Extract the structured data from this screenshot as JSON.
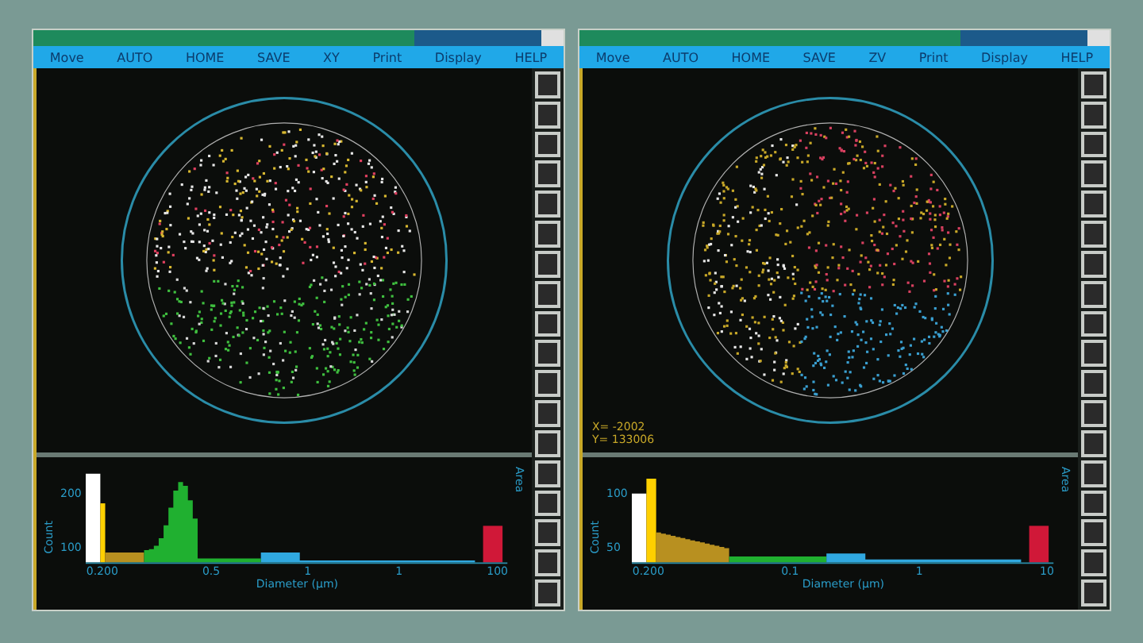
{
  "windows": [
    {
      "menu": [
        "Move",
        "AUTO",
        "HOME",
        "SAVE",
        "XY",
        "Print",
        "Display",
        "HELP"
      ],
      "histogram": {
        "ylabel": "Count",
        "y2label": "Area",
        "xlabel": "Diameter (µm)",
        "yticks": [
          "200",
          "100"
        ],
        "xticks": [
          "0.200",
          "0.5",
          "1",
          "1",
          "100"
        ]
      }
    },
    {
      "menu": [
        "Move",
        "AUTO",
        "HOME",
        "SAVE",
        "ZV",
        "Print",
        "Display",
        "HELP"
      ],
      "coords": [
        "X= -2002",
        "Y= 133006"
      ],
      "histogram": {
        "ylabel": "Count",
        "y2label": "Area",
        "xlabel": "Diameter (µm)",
        "yticks": [
          "100",
          "50"
        ],
        "xticks": [
          "0.200",
          "0.1",
          "1",
          "10"
        ]
      }
    }
  ]
}
